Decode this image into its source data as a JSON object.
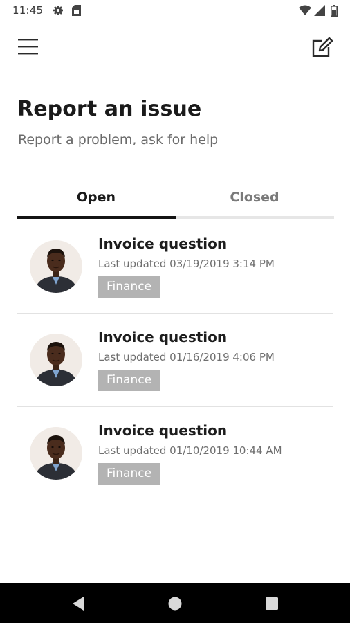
{
  "status_bar": {
    "time": "11:45",
    "icons": [
      "gear-icon",
      "sim-card-icon",
      "wifi-icon",
      "signal-icon",
      "battery-icon"
    ]
  },
  "app_bar": {
    "menu_icon": "hamburger-menu-icon",
    "compose_icon": "edit-compose-icon"
  },
  "header": {
    "title": "Report an issue",
    "subtitle": "Report a problem, ask for help"
  },
  "tabs": [
    {
      "label": "Open",
      "selected": true
    },
    {
      "label": "Closed",
      "selected": false
    }
  ],
  "issues": [
    {
      "title": "Invoice question",
      "updated": "Last updated 03/19/2019 3:14 PM",
      "tag": "Finance"
    },
    {
      "title": "Invoice question",
      "updated": "Last updated 01/16/2019 4:06 PM",
      "tag": "Finance"
    },
    {
      "title": "Invoice question",
      "updated": "Last updated 01/10/2019 10:44 AM",
      "tag": "Finance"
    }
  ],
  "nav_bar": {
    "buttons": [
      "back-icon",
      "home-icon",
      "recents-icon"
    ]
  },
  "colors": {
    "tab_indicator": "#141414",
    "tab_track": "#e6e6e6",
    "tag_background": "#b3b3b3",
    "nav_bar": "#000000"
  }
}
